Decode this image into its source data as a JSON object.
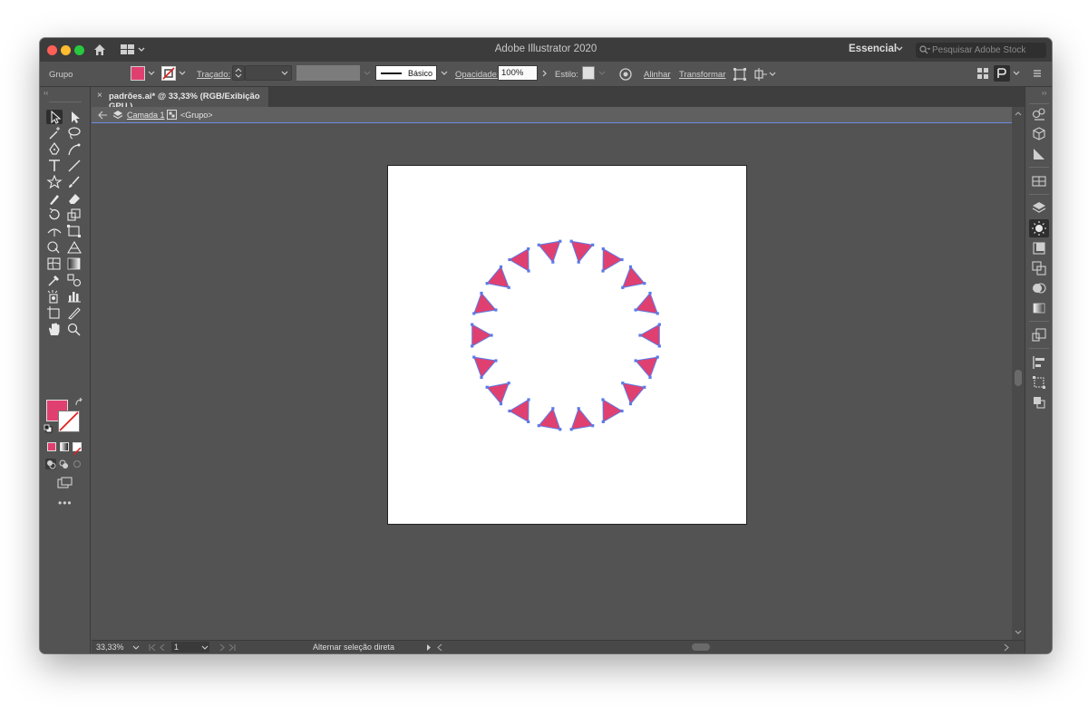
{
  "window": {
    "title": "Adobe Illustrator 2020",
    "workspace_label": "Essencial",
    "stock_search_placeholder": "Pesquisar Adobe Stock"
  },
  "control_bar": {
    "selection_label": "Grupo",
    "stroke_label": "Traçado:",
    "brush_label": "Básico",
    "opacity_label": "Opacidade:",
    "opacity_value": "100%",
    "style_label": "Estilo:",
    "align_label": "Alinhar",
    "transform_label": "Transformar",
    "fill_color": "#e04070"
  },
  "document": {
    "tab_close": "×",
    "tab_title": "padrões.ai* @ 33,33% (RGB/Exibição GPU )",
    "layer_name": "Camada 1",
    "group_name": "<Grupo>"
  },
  "status_bar": {
    "zoom": "33,33%",
    "page": "1",
    "status_text": "Alternar seleção direta"
  },
  "artwork": {
    "shape_count": 18,
    "shape_color": "#e04070",
    "selection_color": "#5b7be8"
  },
  "tools": {
    "fill_color": "#e04070",
    "stroke_color": "#ffffff"
  }
}
